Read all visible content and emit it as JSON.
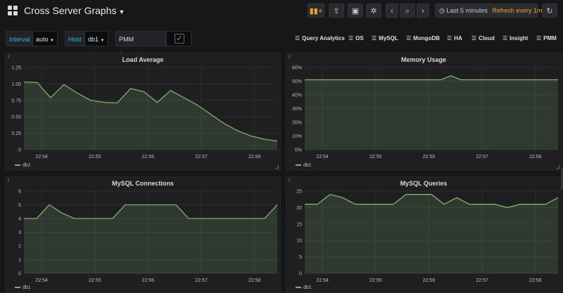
{
  "header": {
    "title": "Cross Server Graphs",
    "time_range": "Last 5 minutes",
    "refresh": "Refresh every 1m"
  },
  "variables": {
    "interval_label": "Interval",
    "interval_value": "auto",
    "host_label": "Host",
    "host_value": "db1",
    "annotations_label": "PMM Annotations",
    "annotations_checked": true
  },
  "links": [
    {
      "label": "Query Analytics"
    },
    {
      "label": "OS"
    },
    {
      "label": "MySQL"
    },
    {
      "label": "MongoDB"
    },
    {
      "label": "HA"
    },
    {
      "label": "Cloud"
    },
    {
      "label": "Insight"
    },
    {
      "label": "PMM"
    }
  ],
  "colors": {
    "series": "#7eb26d",
    "accent_orange": "#f2a332",
    "accent_blue": "#33b5e5"
  },
  "panels": [
    {
      "title": "Load Average",
      "legend": "db1"
    },
    {
      "title": "Memory Usage",
      "legend": "db1"
    },
    {
      "title": "MySQL Connections",
      "legend": "db1"
    },
    {
      "title": "MySQL Queries",
      "legend": "db1"
    }
  ],
  "chart_data": [
    {
      "type": "area",
      "title": "Load Average",
      "x": [
        "22:53:40",
        "22:54:00",
        "22:54:20",
        "22:54:40",
        "22:55:00",
        "22:55:20",
        "22:55:40",
        "22:56:00",
        "22:56:20",
        "22:56:40",
        "22:57:00",
        "22:57:20",
        "22:57:40",
        "22:58:00",
        "22:58:20",
        "22:58:40"
      ],
      "x_ticks": [
        "22:54",
        "22:55",
        "22:56",
        "22:57",
        "22:58"
      ],
      "y_ticks": [
        "0",
        "0.25",
        "0.50",
        "0.75",
        "1.00",
        "1.25"
      ],
      "ylim": [
        0,
        1.25
      ],
      "series": [
        {
          "name": "db1",
          "values": [
            1.03,
            1.02,
            0.79,
            0.99,
            0.86,
            0.75,
            0.72,
            0.71,
            0.93,
            0.88,
            0.72,
            0.9,
            0.79,
            0.68,
            0.54,
            0.4,
            0.29,
            0.21,
            0.16,
            0.13
          ]
        }
      ]
    },
    {
      "type": "area",
      "title": "Memory Usage",
      "x_ticks": [
        "22:54",
        "22:55",
        "22:56",
        "22:57",
        "22:58"
      ],
      "y_ticks": [
        "0%",
        "10%",
        "20%",
        "30%",
        "40%",
        "50%",
        "60%"
      ],
      "ylim": [
        0,
        60
      ],
      "series": [
        {
          "name": "db1",
          "values": [
            51,
            51,
            51,
            51,
            51,
            51,
            51,
            51,
            51,
            51,
            51,
            51,
            51,
            51,
            51,
            54,
            51,
            51,
            51,
            51,
            51,
            51,
            51,
            51,
            51,
            51,
            51
          ]
        }
      ]
    },
    {
      "type": "area",
      "title": "MySQL Connections",
      "x_ticks": [
        "22:54",
        "22:55",
        "22:56",
        "22:57",
        "22:58"
      ],
      "y_ticks": [
        "0",
        "1",
        "2",
        "3",
        "4",
        "5",
        "6"
      ],
      "ylim": [
        0,
        6
      ],
      "series": [
        {
          "name": "db1",
          "values": [
            4,
            4,
            5,
            4.4,
            4,
            4,
            4,
            4,
            5,
            5,
            5,
            5,
            5,
            4,
            4,
            4,
            4,
            4,
            4,
            4,
            5
          ]
        }
      ]
    },
    {
      "type": "area",
      "title": "MySQL Queries",
      "x_ticks": [
        "22:54",
        "22:55",
        "22:56",
        "22:57",
        "22:58"
      ],
      "y_ticks": [
        "0",
        "5",
        "10",
        "15",
        "20",
        "25"
      ],
      "ylim": [
        0,
        25
      ],
      "series": [
        {
          "name": "db1",
          "values": [
            21,
            21,
            24,
            23,
            21,
            21,
            21,
            21,
            24,
            24,
            24,
            21,
            23,
            21,
            21,
            21,
            20,
            21,
            21,
            21,
            23
          ]
        }
      ]
    }
  ]
}
